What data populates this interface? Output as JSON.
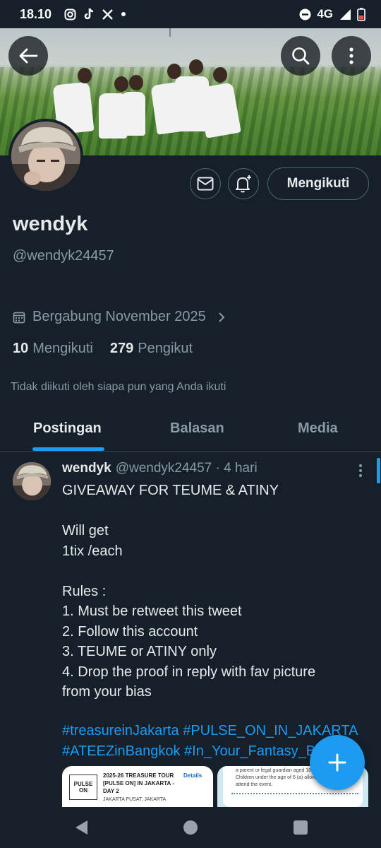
{
  "status_bar": {
    "time": "18.10",
    "network": "4G"
  },
  "profile": {
    "name": "wendyk",
    "handle": "@wendyk24457",
    "joined": "Bergabung November 2025",
    "following_count": "10",
    "following_label": "Mengikuti",
    "followers_count": "279",
    "followers_label": "Pengikut",
    "not_followed_note": "Tidak diikuti oleh siapa pun yang Anda ikuti",
    "follow_button_label": "Mengikuti"
  },
  "tabs": [
    {
      "label": "Postingan",
      "active": true
    },
    {
      "label": "Balasan",
      "active": false
    },
    {
      "label": "Media",
      "active": false
    }
  ],
  "post": {
    "author_name": "wendyk",
    "author_handle": "@wendyk24457",
    "time": "· 4 hari",
    "lines": [
      "GIVEAWAY FOR TEUME & ATINY",
      "",
      "Will get",
      "1tix /each",
      "",
      "Rules :",
      "1. Must be retweet this tweet",
      "2. Follow this account",
      "3. TEUME or ATINY only",
      "4. Drop the proof in reply with fav picture",
      "from your bias"
    ],
    "hashtags_line1": "#treasureinJakarta #PULSE_ON_IN_JAKARTA",
    "hashtags_line2": "#ATEEZinBangkok #In_Your_Fantasy_Bangkok",
    "media1": {
      "logo": "PULSE ON",
      "title": "2025-26 TREASURE TOUR [PULSE ON] IN JAKARTA - DAY 2",
      "details": "Details",
      "location": "JAKARTA PUSAT, JAKARTA"
    },
    "media2": {
      "text": "a parent or legal guardian aged 18 or over. Children under the age of 6 (a) allowed to attend the event."
    }
  },
  "colors": {
    "accent": "#1d9bf0",
    "background": "#15202b",
    "muted": "#8b98a5",
    "border": "#536471"
  }
}
